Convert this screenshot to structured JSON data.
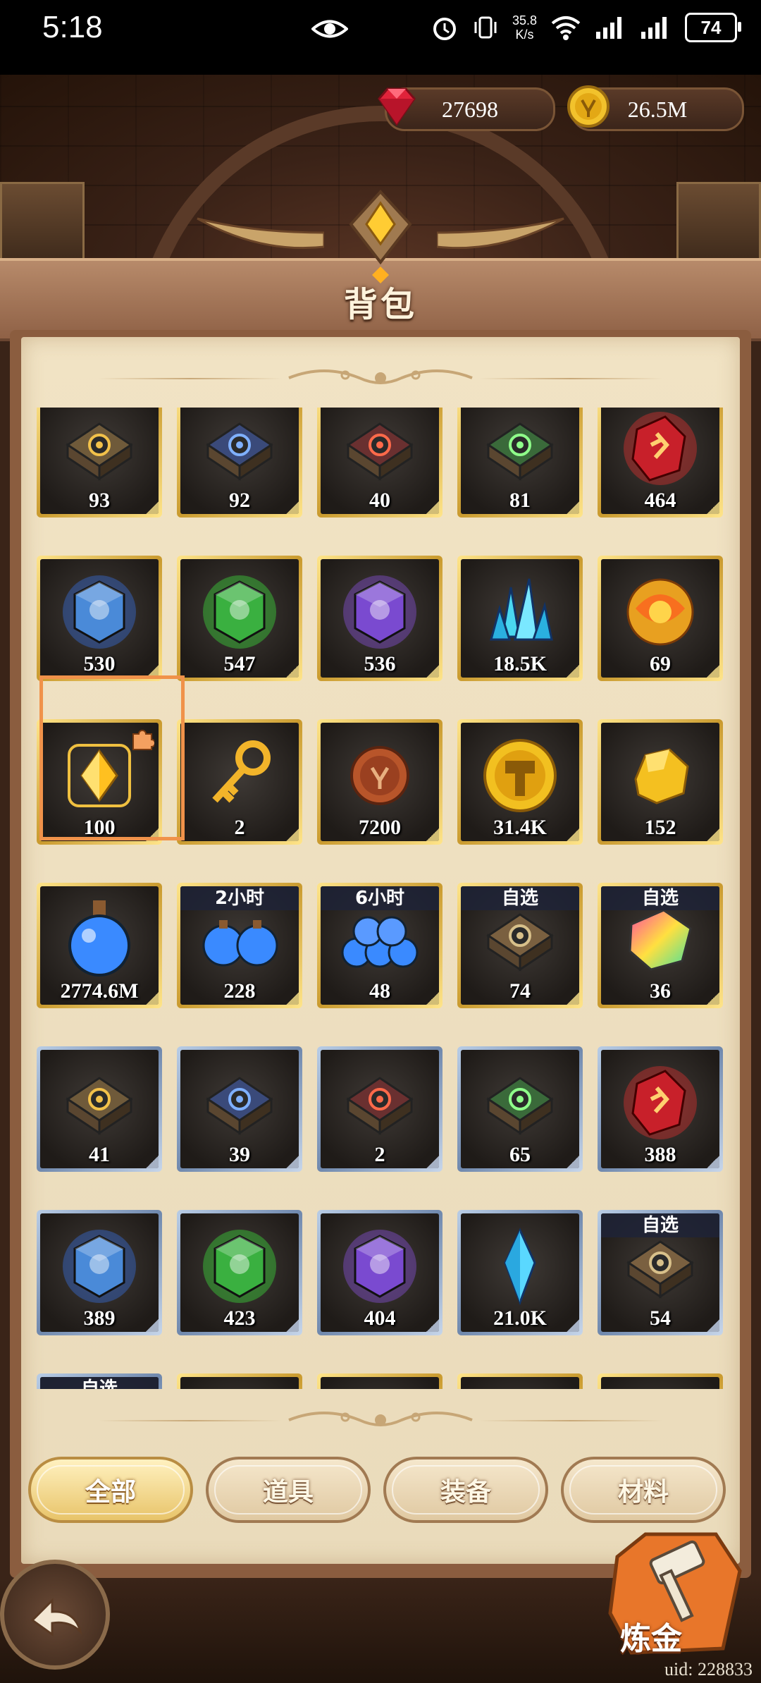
{
  "status_bar": {
    "time": "5:18",
    "net_speed": "35.8",
    "net_unit": "K/s",
    "battery": "74"
  },
  "currency": {
    "gems": "27698",
    "gold": "26.5M"
  },
  "title": "背包",
  "colors": {
    "selection_border": "#f0924a",
    "gold_frame": "#e8c25a",
    "blue_frame": "#8fa6c8",
    "parchment": "#efe0c0"
  },
  "inventory": {
    "rows": [
      [
        {
          "icon": "yellow-skill-book-icon",
          "count": "93",
          "frame": "gold"
        },
        {
          "icon": "blue-skill-book-icon",
          "count": "92",
          "frame": "gold"
        },
        {
          "icon": "red-skill-book-icon",
          "count": "40",
          "frame": "gold"
        },
        {
          "icon": "green-skill-book-icon",
          "count": "81",
          "frame": "gold"
        },
        {
          "icon": "red-rune-crystal-icon",
          "count": "464",
          "frame": "gold"
        }
      ],
      [
        {
          "icon": "blue-stone-icon",
          "count": "530",
          "frame": "gold"
        },
        {
          "icon": "green-stone-icon",
          "count": "547",
          "frame": "gold"
        },
        {
          "icon": "purple-stone-icon",
          "count": "536",
          "frame": "gold"
        },
        {
          "icon": "blue-crystal-shards-icon",
          "count": "18.5K",
          "frame": "gold"
        },
        {
          "icon": "golden-orb-icon",
          "count": "69",
          "frame": "gold"
        }
      ],
      [
        {
          "icon": "gold-gem-fragment-icon",
          "count": "100",
          "frame": "gold",
          "selected": true
        },
        {
          "icon": "gold-key-icon",
          "count": "2",
          "frame": "gold"
        },
        {
          "icon": "bronze-coin-icon",
          "count": "7200",
          "frame": "gold"
        },
        {
          "icon": "hammer-coin-icon",
          "count": "31.4K",
          "frame": "gold"
        },
        {
          "icon": "gold-nugget-icon",
          "count": "152",
          "frame": "gold"
        }
      ],
      [
        {
          "icon": "blue-potion-icon",
          "count": "2774.6M",
          "frame": "gold"
        },
        {
          "icon": "potion-pair-icon",
          "count": "228",
          "frame": "gold",
          "tag": "2小时"
        },
        {
          "icon": "potion-pile-icon",
          "count": "48",
          "frame": "gold",
          "tag": "6小时"
        },
        {
          "icon": "brown-skill-book-icon",
          "count": "74",
          "frame": "gold",
          "tag": "自选"
        },
        {
          "icon": "rainbow-crystal-icon",
          "count": "36",
          "frame": "gold",
          "tag": "自选"
        }
      ],
      [
        {
          "icon": "yellow-skill-book-icon",
          "count": "41",
          "frame": "blue"
        },
        {
          "icon": "blue-skill-book-icon",
          "count": "39",
          "frame": "blue"
        },
        {
          "icon": "red-skill-book-icon",
          "count": "2",
          "frame": "blue"
        },
        {
          "icon": "green-skill-book-icon",
          "count": "65",
          "frame": "blue"
        },
        {
          "icon": "red-rune-crystal-icon",
          "count": "388",
          "frame": "blue"
        }
      ],
      [
        {
          "icon": "blue-stone-icon",
          "count": "389",
          "frame": "blue"
        },
        {
          "icon": "green-stone-icon",
          "count": "423",
          "frame": "blue"
        },
        {
          "icon": "purple-stone-icon",
          "count": "404",
          "frame": "blue"
        },
        {
          "icon": "blue-crystal-icon",
          "count": "21.0K",
          "frame": "blue"
        },
        {
          "icon": "brown-skill-book-icon",
          "count": "54",
          "frame": "blue",
          "tag": "自选"
        }
      ],
      [
        {
          "icon": "partial-item-icon",
          "count": "",
          "frame": "blue",
          "tag": "自选"
        },
        {
          "icon": "partial-item-icon",
          "count": "",
          "frame": "gold"
        },
        {
          "icon": "partial-item-icon",
          "count": "",
          "frame": "gold"
        },
        {
          "icon": "partial-item-icon",
          "count": "",
          "frame": "gold"
        },
        {
          "icon": "partial-item-icon",
          "count": "",
          "frame": "gold"
        }
      ]
    ]
  },
  "tabs": [
    {
      "label": "全部",
      "active": true
    },
    {
      "label": "道具",
      "active": false
    },
    {
      "label": "装备",
      "active": false
    },
    {
      "label": "材料",
      "active": false
    }
  ],
  "alchemy_label": "炼金",
  "uid": "uid: 228833"
}
